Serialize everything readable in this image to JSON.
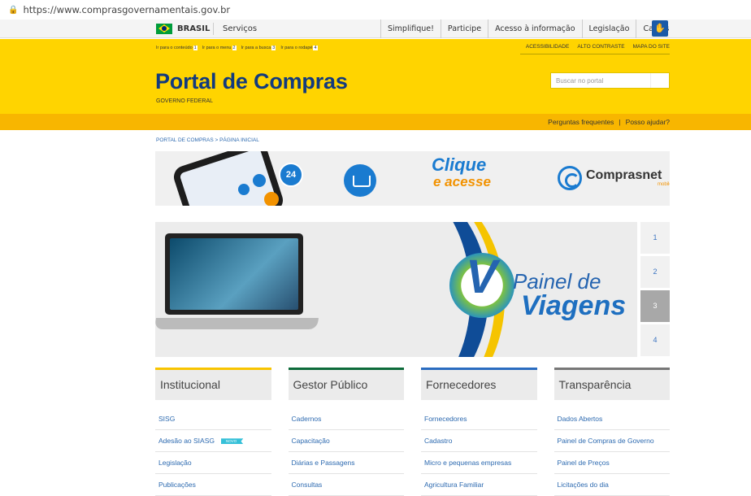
{
  "browser": {
    "url": "https://www.comprasgovernamentais.gov.br"
  },
  "govbar": {
    "brasil": "BRASIL",
    "servicos": "Serviços",
    "nav": [
      "Simplifique!",
      "Participe",
      "Acesso à informação",
      "Legislação",
      "Canais"
    ]
  },
  "header": {
    "skiplinks": [
      {
        "label": "Ir para o conteúdo",
        "key": "1"
      },
      {
        "label": "Ir para o menu",
        "key": "2"
      },
      {
        "label": "Ir para a busca",
        "key": "3"
      },
      {
        "label": "Ir para o rodapé",
        "key": "4"
      }
    ],
    "accessibility": [
      "ACESSIBILIDADE",
      "ALTO CONTRASTE",
      "MAPA DO SITE"
    ],
    "title": "Portal de Compras",
    "subtitle": "GOVERNO FEDERAL",
    "search_placeholder": "Buscar no portal"
  },
  "help": {
    "faq": "Perguntas frequentes",
    "separator": "|",
    "help": "Posso ajudar?"
  },
  "breadcrumb": "PORTAL DE COMPRAS > PÁGINA INICIAL",
  "banner": {
    "clock": "24",
    "clique": "Clique",
    "acesse": "e acesse",
    "brand": "Comprasnet",
    "brand_sub": "mobile"
  },
  "slider": {
    "painel": "Painel de",
    "viagens": "Viagens",
    "pages": [
      "1",
      "2",
      "3",
      "4"
    ],
    "active_page": "3"
  },
  "columns": [
    {
      "title": "Institucional",
      "color": "#f8c400",
      "links": [
        "SISG",
        "Adesão ao SIASG",
        "Legislação",
        "Publicações"
      ]
    },
    {
      "title": "Gestor Público",
      "color": "#0d6b3a",
      "links": [
        "Cadernos",
        "Capacitação",
        "Diárias e Passagens",
        "Consultas"
      ]
    },
    {
      "title": "Fornecedores",
      "color": "#2a6cc0",
      "links": [
        "Fornecedores",
        "Cadastro",
        "Micro e pequenas empresas",
        "Agricultura Familiar"
      ]
    },
    {
      "title": "Transparência",
      "color": "#777777",
      "links": [
        "Dados Abertos",
        "Painel de Compras de Governo",
        "Painel de Preços",
        "Licitações do dia"
      ]
    }
  ],
  "badges": {
    "novo": "NOVO"
  }
}
